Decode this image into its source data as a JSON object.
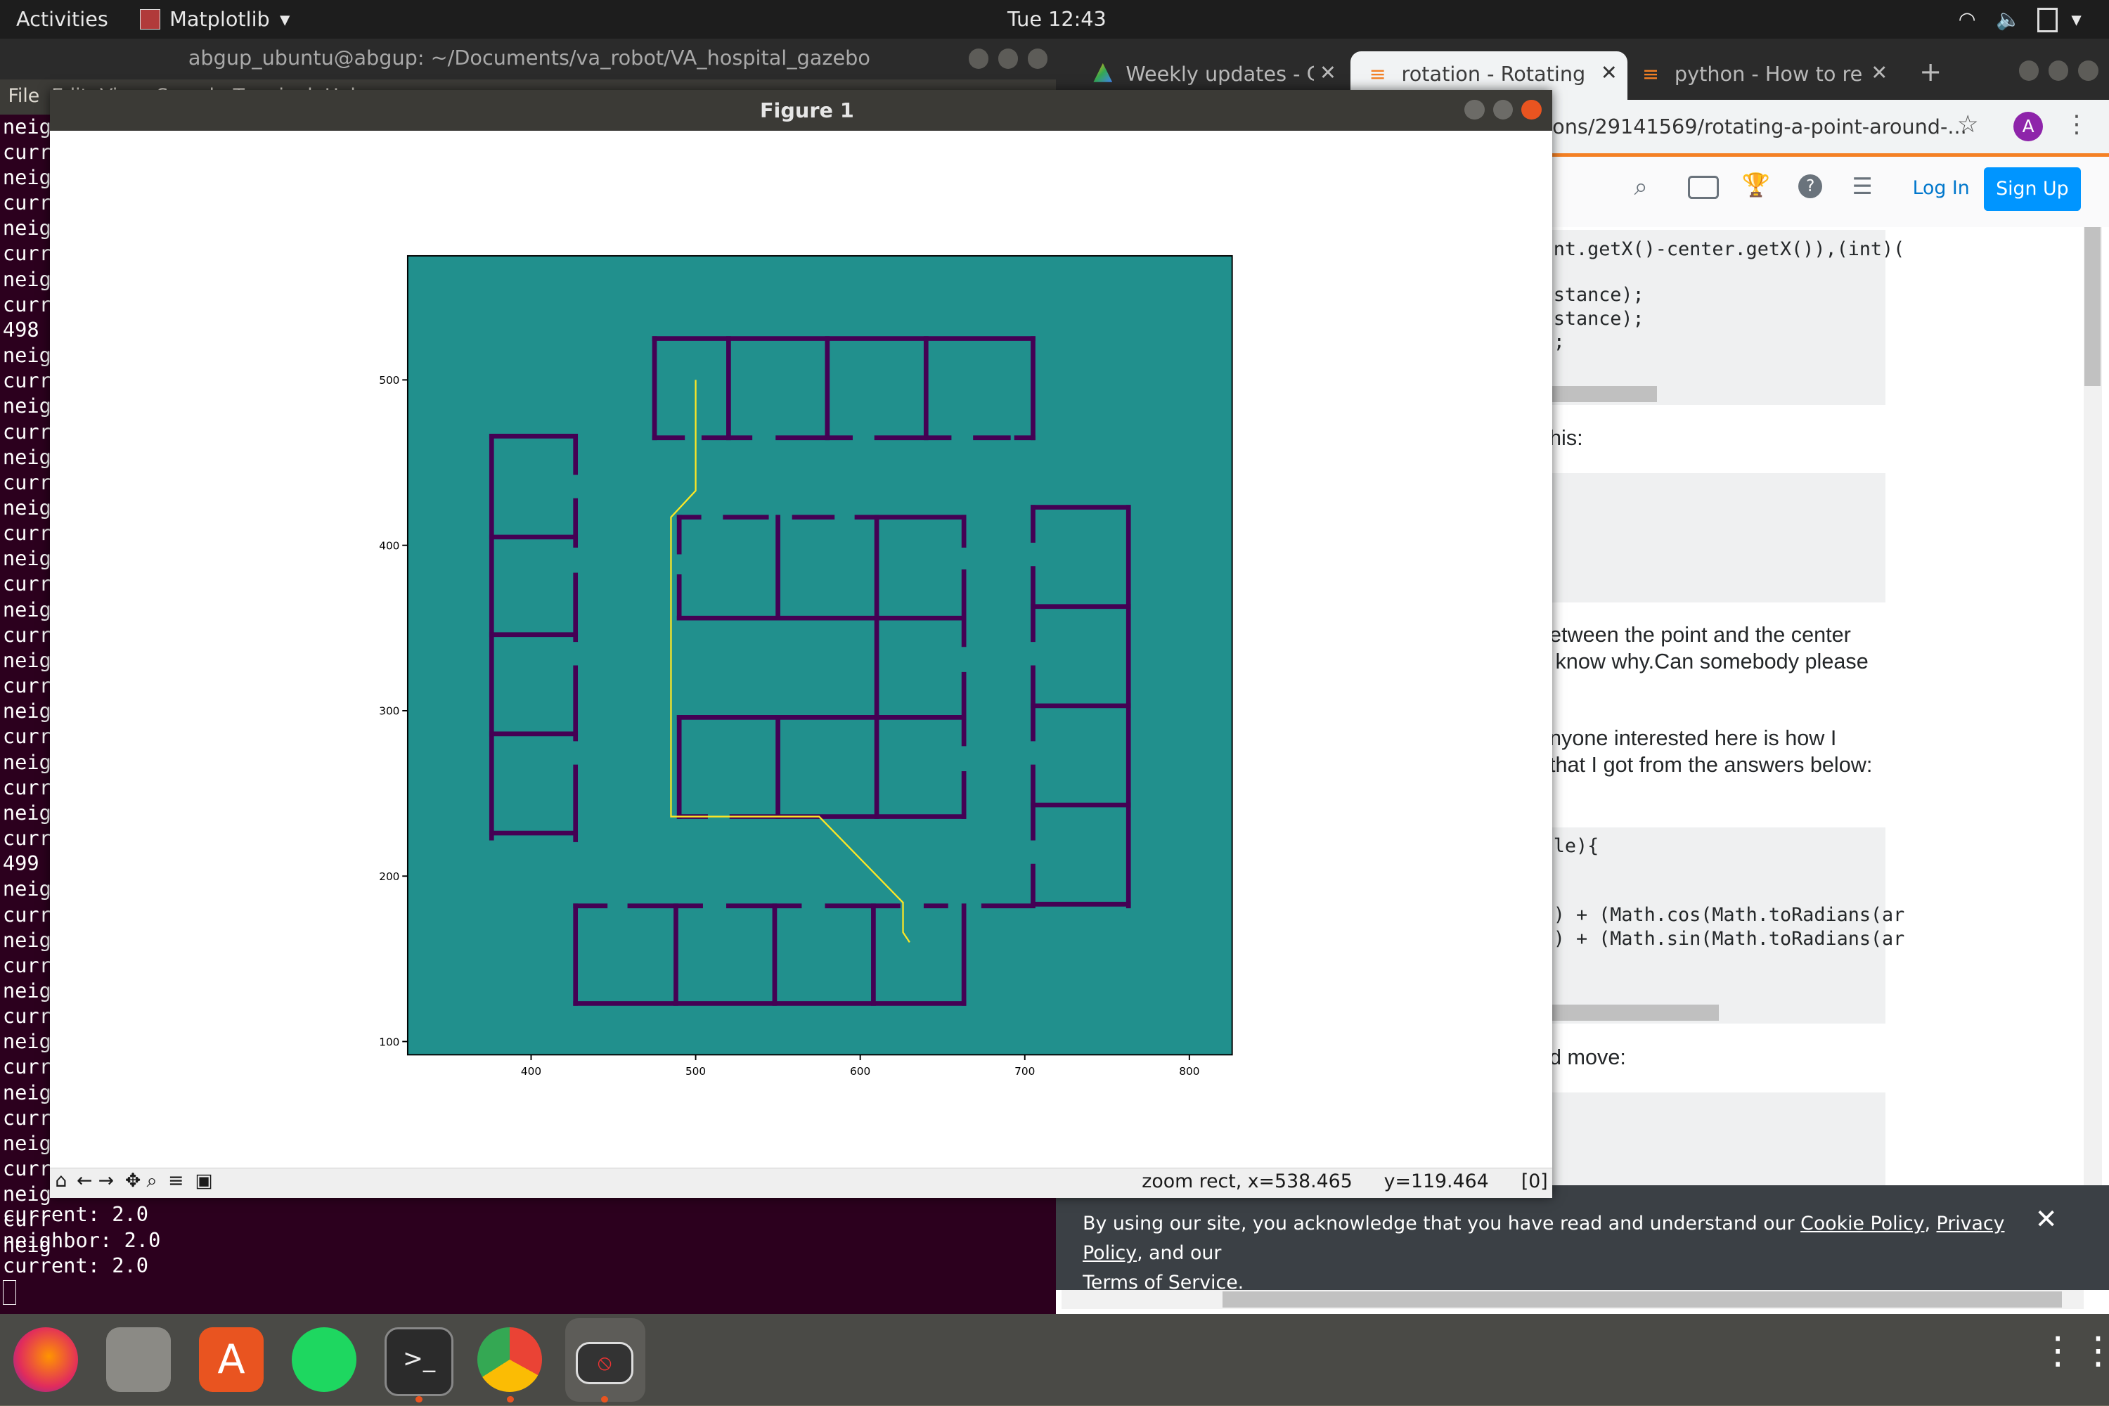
{
  "topbar": {
    "activities": "Activities",
    "app_menu": "Matplotlib",
    "clock": "Tue 12:43"
  },
  "terminal": {
    "title": "abgup_ubuntu@abgup: ~/Documents/va_robot/VA_hospital_gazebo",
    "menu": "File  Edit  View  Search  Terminal  Help",
    "left_column": [
      "neig",
      "curr",
      "neig",
      "curr",
      "neig",
      "curr",
      "neig",
      "curr",
      "498",
      "neig",
      "curr",
      "neig",
      "curr",
      "neig",
      "curr",
      "neig",
      "curr",
      "neig",
      "curr",
      "neig",
      "curr",
      "neig",
      "curr",
      "neig",
      "curr",
      "neig",
      "curr",
      "neig",
      "curr",
      "499",
      "neig",
      "curr",
      "neig",
      "curr",
      "neig",
      "curr",
      "neig",
      "curr",
      "neig",
      "curr",
      "neig",
      "curr",
      "neig",
      "curr",
      "neig",
      "curr",
      "neig"
    ],
    "bottom_lines": [
      "current: 2.0",
      "neighbor: 2.0",
      "current: 2.0"
    ]
  },
  "browser": {
    "tabs": [
      "Weekly updates - G",
      "rotation - Rotating",
      "python - How to re"
    ],
    "url": "ions/29141569/rotating-a-point-around-...",
    "avatar_letter": "A",
    "login": "Log In",
    "signup": "Sign Up",
    "code1": [
      "nt.getX()-center.getX()),(int)(",
      "",
      "stance);",
      "stance);",
      ";"
    ],
    "text_his": "his:",
    "para1": [
      "etween the point and the center",
      " know why.Can somebody please"
    ],
    "para2": [
      "nyone interested here is how I",
      "that I got from the answers below:"
    ],
    "code2": [
      "le){",
      "",
      "",
      ") + (Math.cos(Math.toRadians(ar",
      ") + (Math.sin(Math.toRadians(ar"
    ],
    "text_move": "d move:",
    "cookie": {
      "prefix": "By using our site, you acknowledge that you have read and understand our ",
      "cookie_policy": "Cookie Policy",
      "sep": ", ",
      "privacy_policy": "Privacy Policy",
      "and": ", and our",
      "terms": "Terms of Service",
      "end": "."
    }
  },
  "figure": {
    "title": "Figure 1",
    "status": {
      "mode": "zoom rect, x=538.465",
      "y": "y=119.464",
      "idx": "[0]"
    }
  },
  "chart_data": {
    "type": "image",
    "background_color": "#21908d",
    "wall_color": "#440154",
    "path_color": "#fde725",
    "xlim": [
      325,
      826
    ],
    "ylim": [
      92,
      575
    ],
    "xticks": [
      400,
      500,
      600,
      700,
      800
    ],
    "yticks": [
      100,
      200,
      300,
      400,
      500
    ],
    "walls": [
      [
        [
          475,
          525
        ],
        [
          705,
          525
        ]
      ],
      [
        [
          475,
          525
        ],
        [
          475,
          465
        ]
      ],
      [
        [
          705,
          525
        ],
        [
          705,
          465
        ]
      ],
      [
        [
          520,
          525
        ],
        [
          520,
          465
        ]
      ],
      [
        [
          580,
          525
        ],
        [
          580,
          465
        ]
      ],
      [
        [
          640,
          525
        ],
        [
          640,
          465
        ]
      ],
      [
        [
          475,
          465
        ],
        [
          492,
          465
        ]
      ],
      [
        [
          505,
          465
        ],
        [
          533,
          465
        ]
      ],
      [
        [
          550,
          465
        ],
        [
          594,
          465
        ]
      ],
      [
        [
          610,
          465
        ],
        [
          654,
          465
        ]
      ],
      [
        [
          670,
          465
        ],
        [
          690,
          465
        ]
      ],
      [
        [
          695,
          465
        ],
        [
          705,
          465
        ]
      ],
      [
        [
          376,
          466
        ],
        [
          427,
          466
        ]
      ],
      [
        [
          376,
          466
        ],
        [
          376,
          223
        ]
      ],
      [
        [
          376,
          405
        ],
        [
          427,
          405
        ]
      ],
      [
        [
          376,
          346
        ],
        [
          427,
          346
        ]
      ],
      [
        [
          376,
          286
        ],
        [
          427,
          286
        ]
      ],
      [
        [
          376,
          226
        ],
        [
          427,
          226
        ]
      ],
      [
        [
          427,
          466
        ],
        [
          427,
          444
        ]
      ],
      [
        [
          427,
          427
        ],
        [
          427,
          400
        ]
      ],
      [
        [
          427,
          382
        ],
        [
          427,
          343
        ]
      ],
      [
        [
          427,
          326
        ],
        [
          427,
          283
        ]
      ],
      [
        [
          427,
          266
        ],
        [
          427,
          222
        ]
      ],
      [
        [
          705,
          423
        ],
        [
          763,
          423
        ]
      ],
      [
        [
          763,
          423
        ],
        [
          763,
          182
        ]
      ],
      [
        [
          705,
          363
        ],
        [
          763,
          363
        ]
      ],
      [
        [
          705,
          303
        ],
        [
          763,
          303
        ]
      ],
      [
        [
          705,
          243
        ],
        [
          763,
          243
        ]
      ],
      [
        [
          705,
          183
        ],
        [
          763,
          183
        ]
      ],
      [
        [
          705,
          423
        ],
        [
          705,
          403
        ]
      ],
      [
        [
          705,
          386
        ],
        [
          705,
          343
        ]
      ],
      [
        [
          705,
          326
        ],
        [
          705,
          283
        ]
      ],
      [
        [
          705,
          266
        ],
        [
          705,
          223
        ]
      ],
      [
        [
          705,
          206
        ],
        [
          705,
          183
        ]
      ],
      [
        [
          427,
          182
        ],
        [
          445,
          182
        ]
      ],
      [
        [
          460,
          182
        ],
        [
          503,
          182
        ]
      ],
      [
        [
          520,
          182
        ],
        [
          563,
          182
        ]
      ],
      [
        [
          580,
          182
        ],
        [
          623,
          182
        ]
      ],
      [
        [
          640,
          182
        ],
        [
          652,
          182
        ]
      ],
      [
        [
          675,
          182
        ],
        [
          705,
          182
        ]
      ],
      [
        [
          427,
          182
        ],
        [
          427,
          123
        ]
      ],
      [
        [
          427,
          123
        ],
        [
          663,
          123
        ]
      ],
      [
        [
          488,
          182
        ],
        [
          488,
          123
        ]
      ],
      [
        [
          548,
          182
        ],
        [
          548,
          123
        ]
      ],
      [
        [
          608,
          182
        ],
        [
          608,
          123
        ]
      ],
      [
        [
          663,
          182
        ],
        [
          663,
          123
        ]
      ],
      [
        [
          490,
          417
        ],
        [
          502,
          417
        ]
      ],
      [
        [
          518,
          417
        ],
        [
          543,
          417
        ]
      ],
      [
        [
          560,
          417
        ],
        [
          583,
          417
        ]
      ],
      [
        [
          598,
          417
        ],
        [
          663,
          417
        ]
      ],
      [
        [
          490,
          417
        ],
        [
          490,
          396
        ]
      ],
      [
        [
          490,
          381
        ],
        [
          490,
          356
        ]
      ],
      [
        [
          490,
          356
        ],
        [
          663,
          356
        ]
      ],
      [
        [
          550,
          417
        ],
        [
          550,
          356
        ]
      ],
      [
        [
          610,
          417
        ],
        [
          610,
          296
        ]
      ],
      [
        [
          663,
          417
        ],
        [
          663,
          400
        ]
      ],
      [
        [
          663,
          384
        ],
        [
          663,
          340
        ]
      ],
      [
        [
          663,
          322
        ],
        [
          663,
          280
        ]
      ],
      [
        [
          663,
          262
        ],
        [
          663,
          236
        ]
      ],
      [
        [
          490,
          296
        ],
        [
          663,
          296
        ]
      ],
      [
        [
          490,
          296
        ],
        [
          490,
          236
        ]
      ],
      [
        [
          550,
          296
        ],
        [
          550,
          236
        ]
      ],
      [
        [
          610,
          296
        ],
        [
          610,
          236
        ]
      ],
      [
        [
          490,
          236
        ],
        [
          506,
          236
        ]
      ],
      [
        [
          522,
          236
        ],
        [
          663,
          236
        ]
      ]
    ],
    "path": [
      [
        500,
        500
      ],
      [
        500,
        433
      ],
      [
        485,
        417
      ],
      [
        485,
        236
      ],
      [
        575,
        236
      ],
      [
        626,
        184
      ],
      [
        626,
        166
      ],
      [
        630,
        160
      ]
    ]
  }
}
